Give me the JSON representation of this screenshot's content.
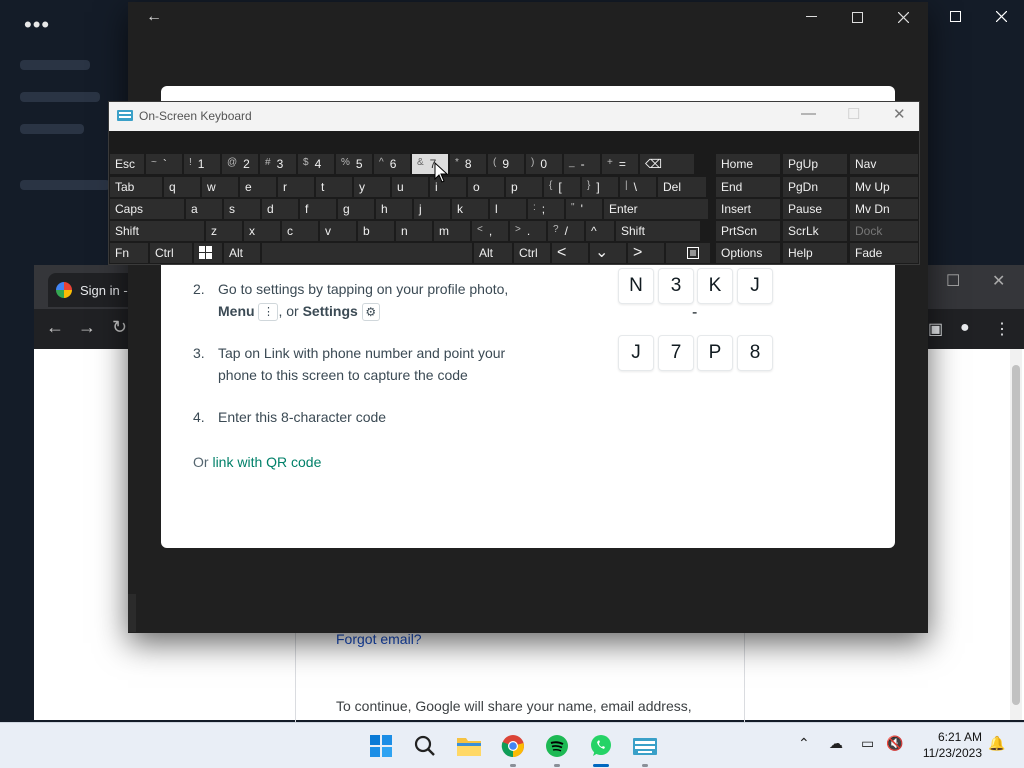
{
  "background_app": {
    "menu_dots": "•••"
  },
  "chrome": {
    "tab_title": "Sign in - G",
    "forgot_email": "Forgot email?",
    "continue_text": "To continue, Google will share your name, email address,"
  },
  "whatsapp": {
    "steps": [
      {
        "num": "2.",
        "line1": "Go to settings by tapping on your profile photo,",
        "menu_label": "Menu",
        "or_text": ", or",
        "settings_label": "Settings"
      },
      {
        "num": "3.",
        "line1": "Tap on Link with phone number and point your",
        "line2": "phone to this screen to capture the code"
      },
      {
        "num": "4.",
        "line1": "Enter this 8-character code"
      }
    ],
    "or_prefix": "Or",
    "qr_link": "link with QR code",
    "code_row1": [
      "N",
      "3",
      "K",
      "J"
    ],
    "code_dash": "-",
    "code_row2": [
      "J",
      "7",
      "P",
      "8"
    ]
  },
  "osk": {
    "title": "On-Screen Keyboard",
    "row1": [
      {
        "main": "Esc"
      },
      {
        "sm": "~",
        "main": "`"
      },
      {
        "sm": "!",
        "main": "1"
      },
      {
        "sm": "@",
        "main": "2"
      },
      {
        "sm": "#",
        "main": "3"
      },
      {
        "sm": "$",
        "main": "4"
      },
      {
        "sm": "%",
        "main": "5"
      },
      {
        "sm": "^",
        "main": "6"
      },
      {
        "sm": "&",
        "main": "7"
      },
      {
        "sm": "*",
        "main": "8"
      },
      {
        "sm": "(",
        "main": "9"
      },
      {
        "sm": ")",
        "main": "0"
      },
      {
        "sm": "_",
        "main": "-"
      },
      {
        "sm": "+",
        "main": "="
      },
      {
        "main": "⌫"
      }
    ],
    "row2": [
      "Tab",
      "q",
      "w",
      "e",
      "r",
      "t",
      "y",
      "u",
      "i",
      "o",
      "p",
      "[",
      "]",
      "\\",
      "Del"
    ],
    "row2_sm": [
      "",
      "",
      "",
      "",
      "",
      "",
      "",
      "",
      "",
      "",
      "",
      "{",
      "}",
      "|",
      ""
    ],
    "row3": [
      "Caps",
      "a",
      "s",
      "d",
      "f",
      "g",
      "h",
      "j",
      "k",
      "l",
      ";",
      "'",
      "Enter"
    ],
    "row3_sm": [
      "",
      "",
      "",
      "",
      "",
      "",
      "",
      "",
      "",
      "",
      ":",
      "\"",
      ""
    ],
    "row4": [
      "Shift",
      "z",
      "x",
      "c",
      "v",
      "b",
      "n",
      "m",
      ",",
      ".",
      "/",
      "^",
      "Shift"
    ],
    "row4_sm": [
      "",
      "",
      "",
      "",
      "",
      "",
      "",
      "",
      "<",
      ">",
      "?",
      "",
      ""
    ],
    "row5": [
      "Fn",
      "Ctrl",
      "Alt",
      "Alt",
      "Ctrl"
    ],
    "nav_keys": [
      [
        "Home",
        "PgUp",
        "Nav"
      ],
      [
        "End",
        "PgDn",
        "Mv Up"
      ],
      [
        "Insert",
        "Pause",
        "Mv Dn"
      ],
      [
        "PrtScn",
        "ScrLk",
        "Dock"
      ],
      [
        "Options",
        "Help",
        "Fade"
      ]
    ]
  },
  "taskbar": {
    "time": "6:21 AM",
    "date": "11/23/2023"
  }
}
